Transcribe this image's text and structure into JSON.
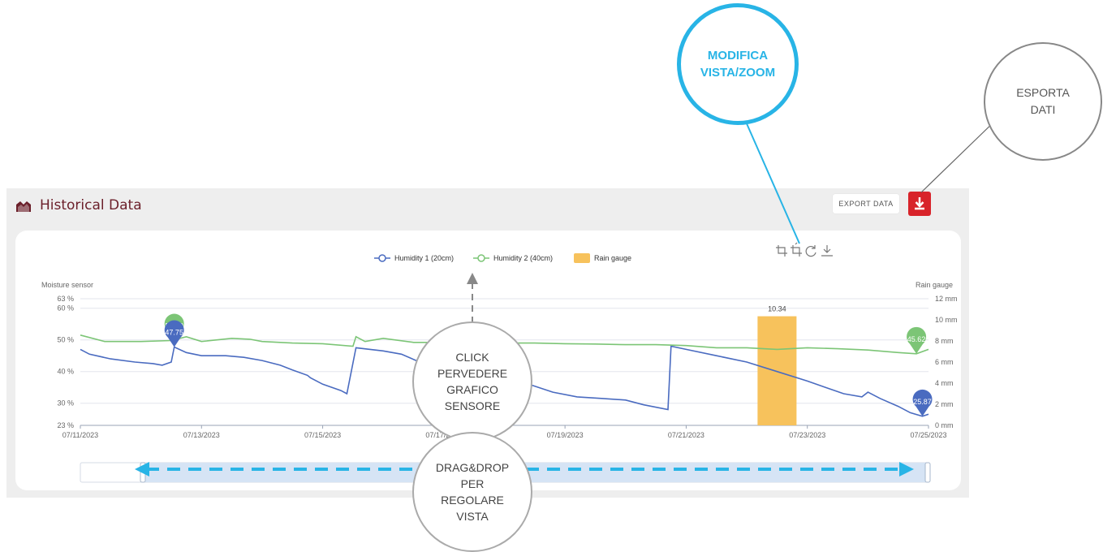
{
  "panel": {
    "title": "Historical Data",
    "export_label": "EXPORT DATA",
    "accent": "#d8232a",
    "title_color": "#6b1f2a"
  },
  "toolbox": [
    "crop-icon",
    "crop-back-icon",
    "refresh-icon",
    "download-icon"
  ],
  "annotations": {
    "zoom": [
      "MODIFICA",
      "VISTA/ZOOM"
    ],
    "export": [
      "ESPORTA",
      "DATI"
    ],
    "click": [
      "CLICK",
      "PERVEDERE",
      "GRAFICO",
      "SENSORE"
    ],
    "drag": [
      "DRAG&DROP",
      "PER",
      "REGOLARE",
      "VISTA"
    ],
    "zoom_color": "#28b4e6"
  },
  "chart_data": {
    "type": "line",
    "legend": [
      {
        "name": "Humidity 1 (20cm)",
        "color": "#4a6bc0",
        "kind": "line"
      },
      {
        "name": "Humidity 2 (40cm)",
        "color": "#7cc576",
        "kind": "line"
      },
      {
        "name": "Rain gauge",
        "color": "#f7c25c",
        "kind": "bar"
      }
    ],
    "ylabel_left": "Moisture sensor",
    "ylabel_right": "Rain gauge",
    "y_left_ticks": [
      "63 %",
      "60 %",
      "50 %",
      "40 %",
      "30 %",
      "23 %"
    ],
    "y_left_values": [
      63,
      60,
      50,
      40,
      30,
      23
    ],
    "y_left_range": [
      23,
      63
    ],
    "y_right_ticks": [
      "12 mm",
      "10 mm",
      "8 mm",
      "6 mm",
      "4 mm",
      "2 mm",
      "0 mm"
    ],
    "y_right_values": [
      12,
      10,
      8,
      6,
      4,
      2,
      0
    ],
    "y_right_range": [
      0,
      12
    ],
    "x_ticks": [
      "07/11/2023",
      "07/13/2023",
      "07/15/2023",
      "07/17/2023",
      "07/19/2023",
      "07/21/2023",
      "07/23/2023",
      "07/25/2023"
    ],
    "x_tick_days": [
      0,
      2,
      4,
      6,
      8,
      10,
      12,
      14
    ],
    "series": [
      {
        "name": "Humidity 1 (20cm)",
        "color": "#4a6bc0",
        "x": [
          0,
          0.15,
          0.5,
          0.9,
          1.2,
          1.35,
          1.5,
          1.55,
          1.75,
          2.0,
          2.4,
          2.7,
          3.0,
          3.3,
          3.5,
          3.75,
          3.8,
          4.0,
          4.3,
          4.4,
          4.55,
          5.0,
          5.3,
          5.6,
          6.0,
          6.3,
          6.6,
          7.0,
          7.4,
          7.8,
          8.2,
          8.6,
          9.0,
          9.3,
          9.7,
          9.75,
          10.0,
          10.5,
          11.0,
          11.5,
          12.0,
          12.3,
          12.6,
          12.9,
          13.0,
          13.2,
          13.5,
          13.7,
          13.9,
          14.0
        ],
        "y": [
          47,
          45.5,
          44.0,
          43.0,
          42.5,
          42.0,
          43.0,
          47.75,
          46.0,
          45.0,
          45.0,
          44.5,
          43.5,
          42.0,
          40.5,
          38.8,
          38.0,
          36.0,
          34.0,
          33.0,
          47.5,
          46.5,
          45.5,
          43.0,
          39.5,
          38.5,
          38.5,
          38.0,
          36.0,
          33.5,
          32.0,
          31.5,
          31.0,
          29.5,
          28.0,
          48.0,
          47.0,
          45.0,
          43.0,
          40.0,
          37.0,
          35.0,
          33.0,
          32.0,
          33.5,
          31.5,
          29.0,
          27.0,
          25.87,
          26.5
        ]
      },
      {
        "name": "Humidity 2 (40cm)",
        "color": "#7cc576",
        "x": [
          0,
          0.4,
          1.0,
          1.5,
          1.75,
          2.0,
          2.5,
          2.8,
          3.0,
          3.5,
          4.0,
          4.5,
          4.55,
          4.7,
          5.0,
          5.5,
          6.0,
          6.5,
          7.0,
          7.5,
          8.0,
          8.5,
          9.0,
          9.5,
          10.0,
          10.5,
          11.0,
          11.5,
          12.0,
          12.5,
          13.0,
          13.5,
          13.8,
          14.0
        ],
        "y": [
          51.5,
          49.5,
          49.5,
          49.8,
          51.0,
          49.5,
          50.5,
          50.2,
          49.5,
          49.0,
          48.8,
          48.0,
          51.0,
          49.5,
          50.5,
          49.2,
          49.2,
          49.0,
          49.0,
          49.0,
          48.8,
          48.7,
          48.5,
          48.5,
          48.2,
          47.5,
          47.5,
          47.0,
          47.5,
          47.2,
          46.8,
          46.0,
          45.62,
          47.0
        ]
      },
      {
        "name": "Rain gauge",
        "color": "#f7c25c",
        "type": "bar",
        "x": [
          11.5
        ],
        "values": [
          10.34
        ]
      }
    ],
    "markpoints": [
      {
        "series": "Humidity 2 (40cm)",
        "x": 1.55,
        "y": 49.8,
        "label": "56.69"
      },
      {
        "series": "Humidity 1 (20cm)",
        "x": 1.55,
        "y": 47.75,
        "label": "47.75"
      },
      {
        "series": "Humidity 2 (40cm)",
        "x": 13.8,
        "y": 45.62,
        "label": "45.62"
      },
      {
        "series": "Humidity 1 (20cm)",
        "x": 13.9,
        "y": 25.87,
        "label": "25.87"
      }
    ],
    "bar_label": "10.34",
    "grid": true,
    "legend_position": "top"
  }
}
